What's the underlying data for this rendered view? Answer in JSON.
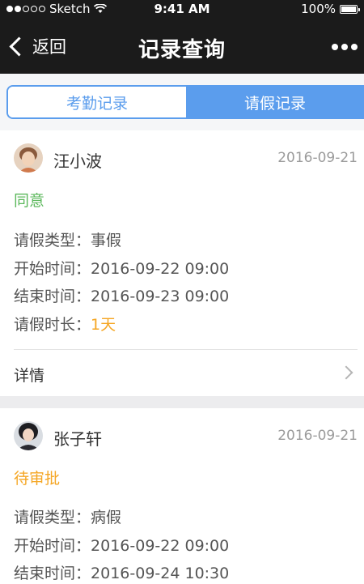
{
  "status_bar": {
    "carrier": "Sketch",
    "time": "9:41 AM",
    "battery": "100%"
  },
  "nav": {
    "back_label": "返回",
    "title": "记录查询"
  },
  "tabs": [
    {
      "label": "考勤记录",
      "active": false
    },
    {
      "label": "请假记录",
      "active": true
    }
  ],
  "colors": {
    "accent": "#5b9ded",
    "approved": "#5cb85c",
    "pending": "#f5a623"
  },
  "records": [
    {
      "name": "汪小波",
      "date": "2016-09-21",
      "status": "同意",
      "leave_type_label": "请假类型：",
      "leave_type": "事假",
      "start_label": "开始时间：",
      "start": "2016-09-22 09:00",
      "end_label": "结束时间：",
      "end": "2016-09-23 09:00",
      "duration_label": "请假时长：",
      "duration": "1天",
      "detail_label": "详情"
    },
    {
      "name": "张子轩",
      "date": "2016-09-21",
      "status": "待审批",
      "leave_type_label": "请假类型：",
      "leave_type": "病假",
      "start_label": "开始时间：",
      "start": "2016-09-22 09:00",
      "end_label": "结束时间：",
      "end": "2016-09-24 10:30"
    }
  ]
}
